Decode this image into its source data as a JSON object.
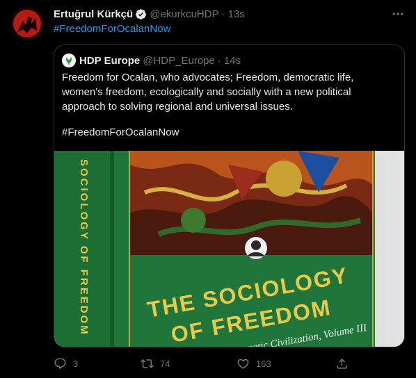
{
  "author": {
    "name": "Ertuğrul Kürkçü",
    "handle": "@ekurkcuHDP",
    "separator": "·",
    "time": "13s"
  },
  "tweet": {
    "hashtag": "#FreedomForOcalanNow"
  },
  "quoted": {
    "name": "HDP Europe",
    "handle": "@HDP_Europe",
    "separator": "·",
    "time": "14s",
    "text": "Freedom for Ocalan, who advocates; Freedom, democratic life, women's freedom, ecologically and socially with a new political approach to solving regional and universal issues.",
    "hashtag": "#FreedomForOcalanNow",
    "book": {
      "spine_title": "SOCIOLOGY OF FREEDOM",
      "cover_title_line1": "THE SOCIOLOGY",
      "cover_title_line2": "OF FREEDOM",
      "cover_subtitle": "Democratic Civilization, Volume III"
    }
  },
  "actions": {
    "replies": "3",
    "retweets": "74",
    "likes": "163"
  },
  "icons": {
    "verified": "verified-badge-icon",
    "more": "more-options-icon",
    "reply": "reply-icon",
    "retweet": "retweet-icon",
    "like": "like-icon",
    "share": "share-icon"
  },
  "colors": {
    "background": "#000000",
    "link": "#1d9bf0",
    "muted": "#71767b",
    "text": "#e7e9ea",
    "border": "#2f3336",
    "book_green": "#1f7a3a",
    "book_title": "#e8c94a"
  }
}
